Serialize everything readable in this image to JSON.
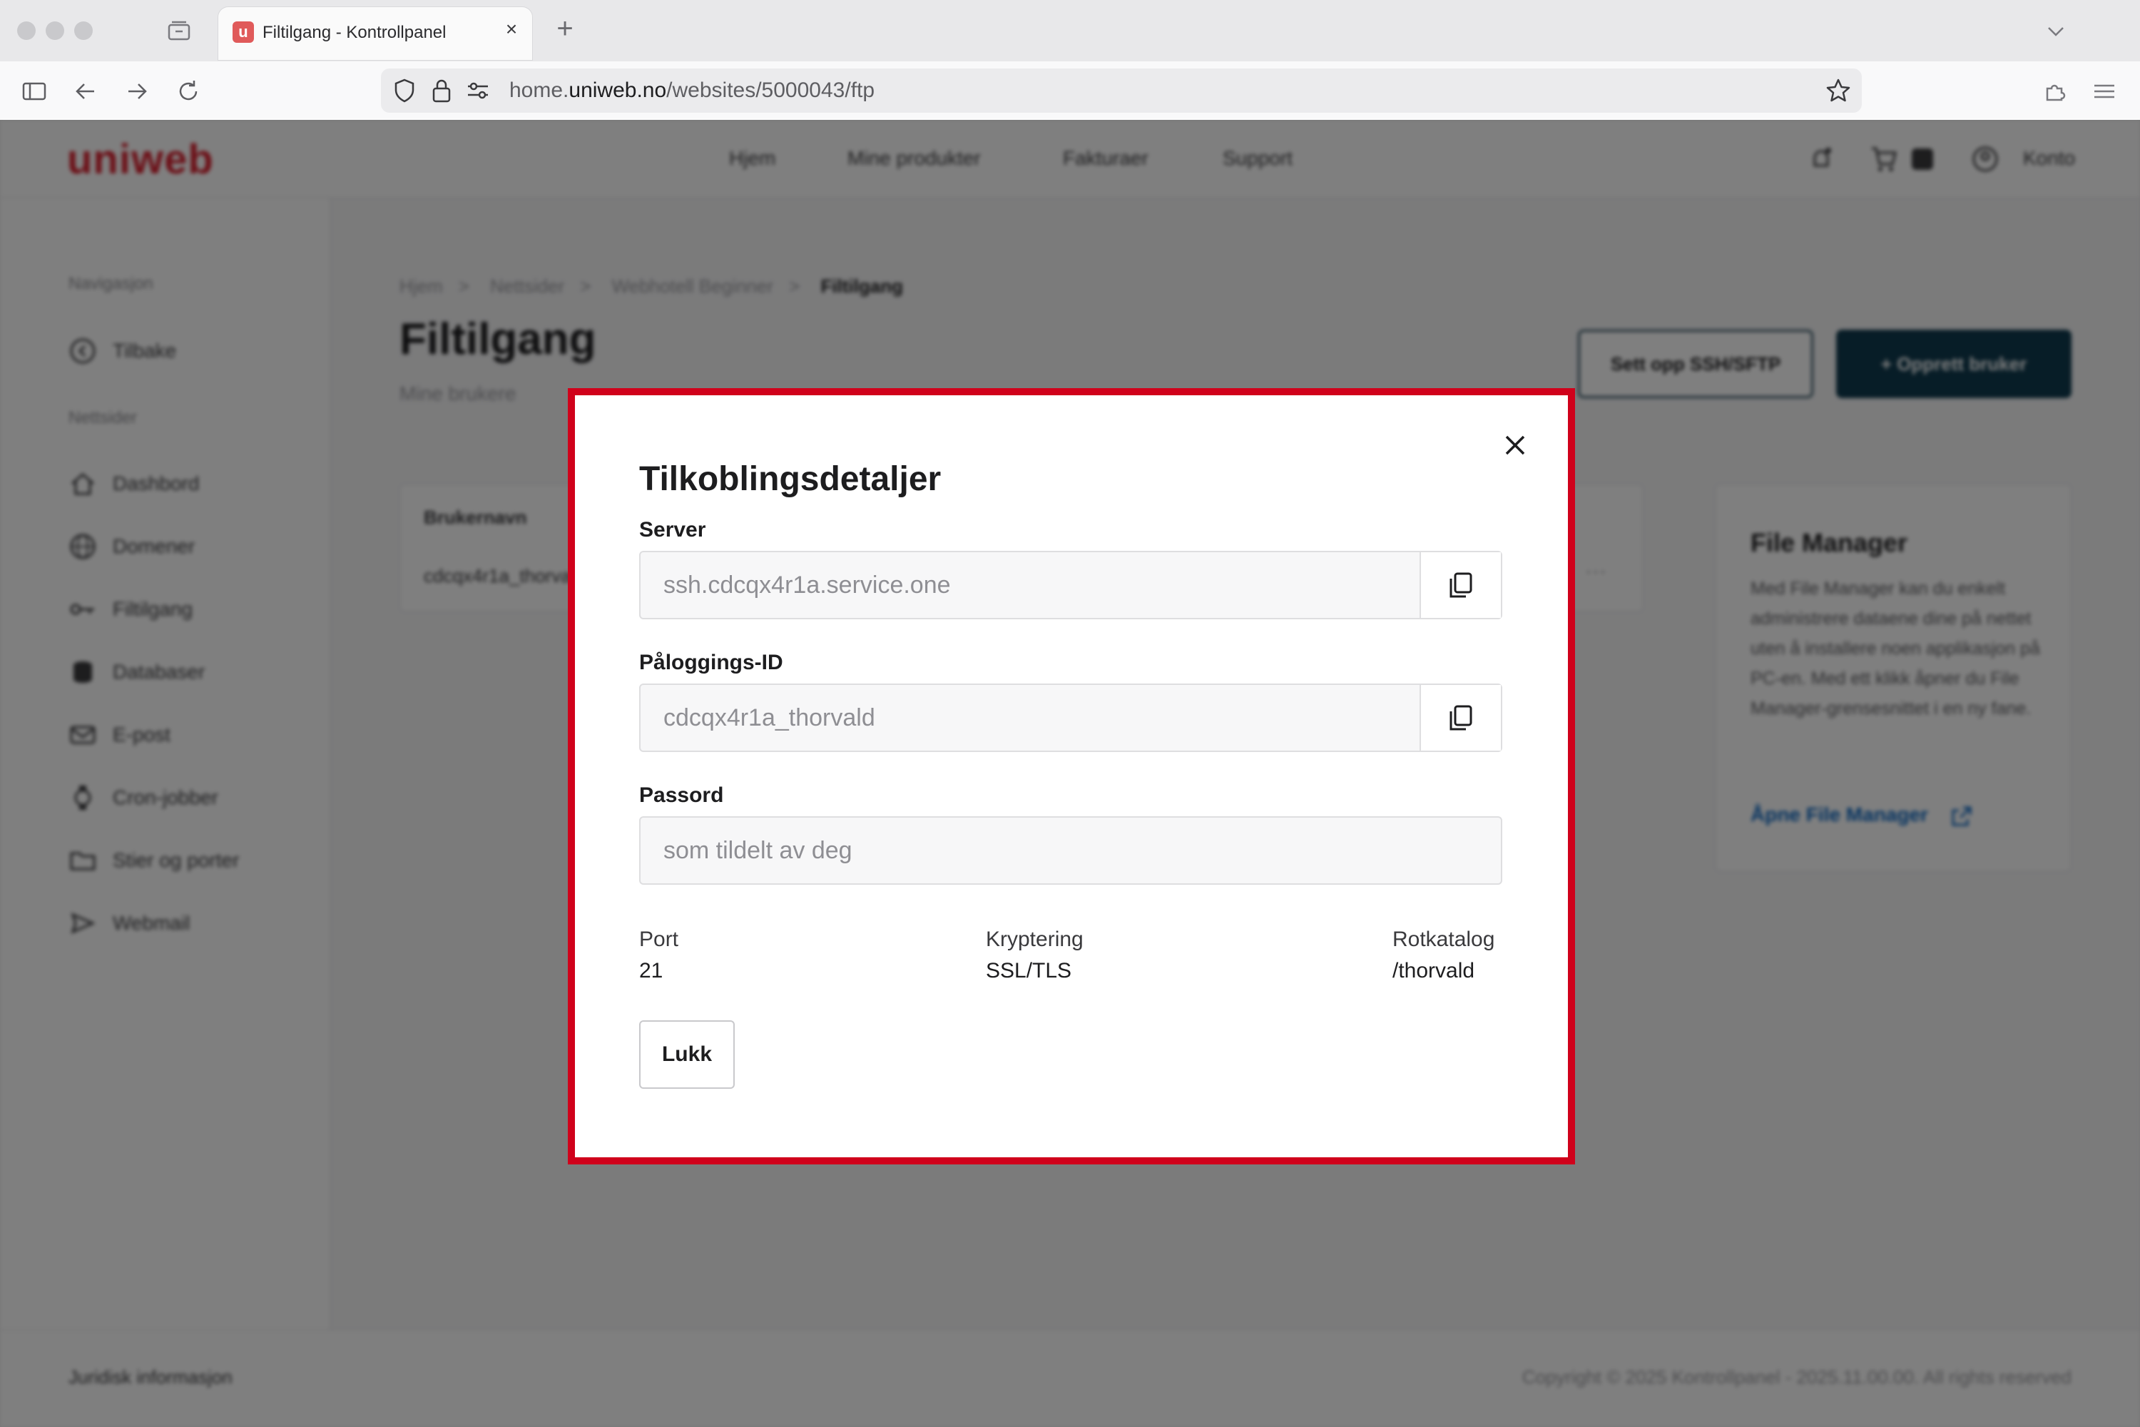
{
  "browser": {
    "tab_title": "Filtilgang - Kontrollpanel",
    "favicon_letter": "u",
    "url_prefix": "home.",
    "url_host": "uniweb.no",
    "url_path": "/websites/5000043/ftp",
    "new_tab_symbol": "+",
    "close_symbol": "×"
  },
  "site": {
    "logo": "uniweb",
    "nav": [
      "Hjem",
      "Mine produkter",
      "Fakturaer",
      "Support"
    ],
    "account_label": "Konto"
  },
  "sidebar": {
    "heading_nav": "Navigasjon",
    "back_label": "Tilbake",
    "heading_sites": "Nettsider",
    "items": [
      "Dashbord",
      "Domener",
      "Filtilgang",
      "Databaser",
      "E-post",
      "Cron-jobber",
      "Stier og porter",
      "Webmail"
    ]
  },
  "breadcrumb": [
    "Hjem",
    "Nettsider",
    "Webhotell Beginner",
    "Filtilgang"
  ],
  "breadcrumb_sep": ">",
  "page": {
    "title": "Filtilgang",
    "subtitle": "Mine brukere",
    "btn_ssh": "Sett opp SSH/SFTP",
    "btn_create": "+ Opprett bruker"
  },
  "table": {
    "header": "Brukernavn",
    "row_value": "cdcqx4r1a_thorvald",
    "row_more": "···"
  },
  "file_manager": {
    "title": "File Manager",
    "text": "Med File Manager kan du enkelt administrere dataene dine på nettet uten å installere noen applikasjon på PC-en. Med ett klikk åpner du File Manager-grensesnittet i en ny fane.",
    "link": "Åpne File Manager"
  },
  "footer": {
    "left": "Juridisk informasjon",
    "right": "Copyright © 2025 Kontrollpanel - 2025.11.00.00. All rights reserved"
  },
  "modal": {
    "title": "Tilkoblingsdetaljer",
    "server_label": "Server",
    "server_value": "ssh.cdcqx4r1a.service.one",
    "login_label": "Påloggings-ID",
    "login_value": "cdcqx4r1a_thorvald",
    "password_label": "Passord",
    "password_value": "som tildelt av deg",
    "port_label": "Port",
    "port_value": "21",
    "encryption_label": "Kryptering",
    "encryption_value": "SSL/TLS",
    "root_label": "Rotkatalog",
    "root_value": "/thorvald",
    "close_button": "Lukk",
    "accent_color": "#d0011b"
  }
}
